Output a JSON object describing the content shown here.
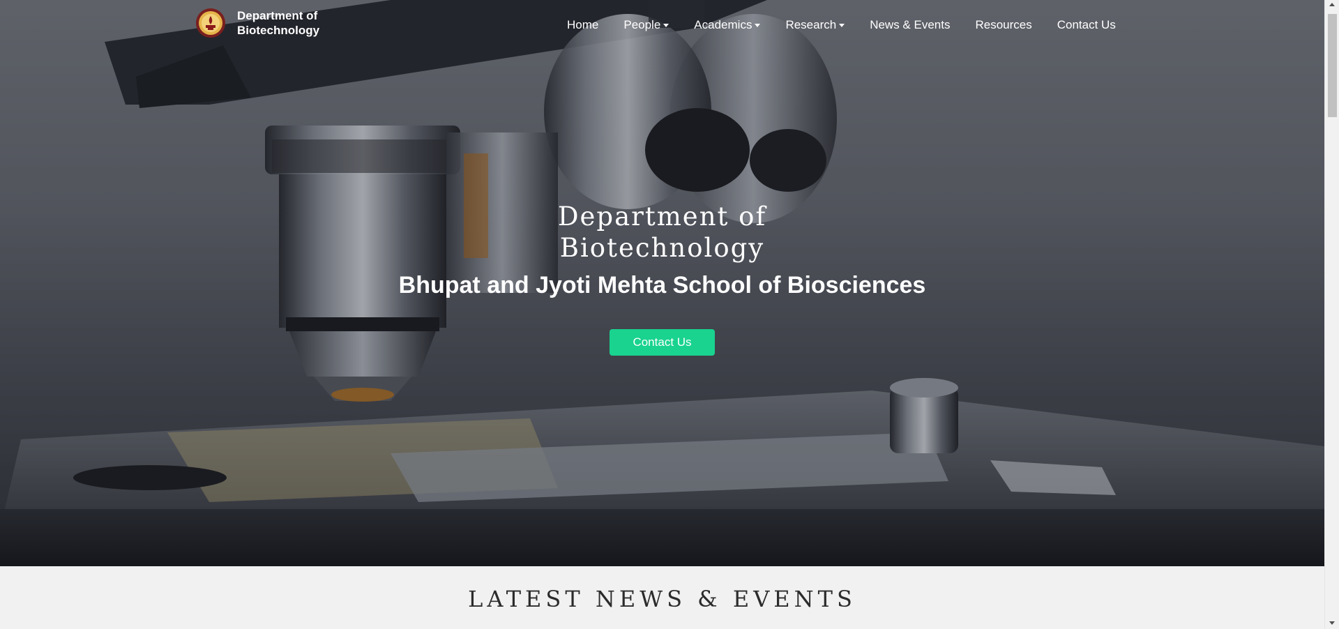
{
  "brand": {
    "line1": "Department of",
    "line2": "Biotechnology",
    "logo_icon": "institute-seal-icon"
  },
  "nav": {
    "items": [
      {
        "label": "Home",
        "dropdown": false
      },
      {
        "label": "People",
        "dropdown": true
      },
      {
        "label": "Academics",
        "dropdown": true
      },
      {
        "label": "Research",
        "dropdown": true
      },
      {
        "label": "News & Events",
        "dropdown": false
      },
      {
        "label": "Resources",
        "dropdown": false
      },
      {
        "label": "Contact Us",
        "dropdown": false
      }
    ]
  },
  "hero": {
    "title_line1": "Department of",
    "title_line2": "Biotechnology",
    "subtitle": "Bhupat and Jyoti Mehta School of Biosciences",
    "cta_label": "Contact Us",
    "background": "microscope-photo"
  },
  "news": {
    "heading": "LATEST NEWS & EVENTS"
  },
  "colors": {
    "accent": "#19d38f",
    "nav_text": "#ffffff",
    "section_bg": "#f1f1f1"
  }
}
